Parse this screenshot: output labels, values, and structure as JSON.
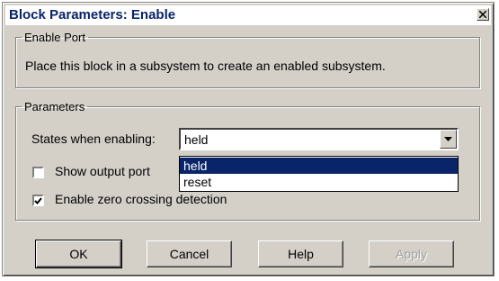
{
  "dialog": {
    "title": "Block Parameters: Enable",
    "close_icon": "close-icon"
  },
  "enable_port": {
    "legend": "Enable Port",
    "description": "Place this block in a subsystem to create an enabled subsystem."
  },
  "parameters": {
    "legend": "Parameters",
    "states_label": "States when enabling:",
    "states_value": "held",
    "states_options": [
      "held",
      "reset"
    ],
    "show_output_port_label": "Show output port",
    "show_output_port_checked": false,
    "zero_crossing_label": "Enable zero crossing detection",
    "zero_crossing_checked": true
  },
  "buttons": {
    "ok": "OK",
    "cancel": "Cancel",
    "help": "Help",
    "apply": "Apply"
  },
  "colors": {
    "selection": "#0a246a",
    "face": "#d4d0c8"
  }
}
